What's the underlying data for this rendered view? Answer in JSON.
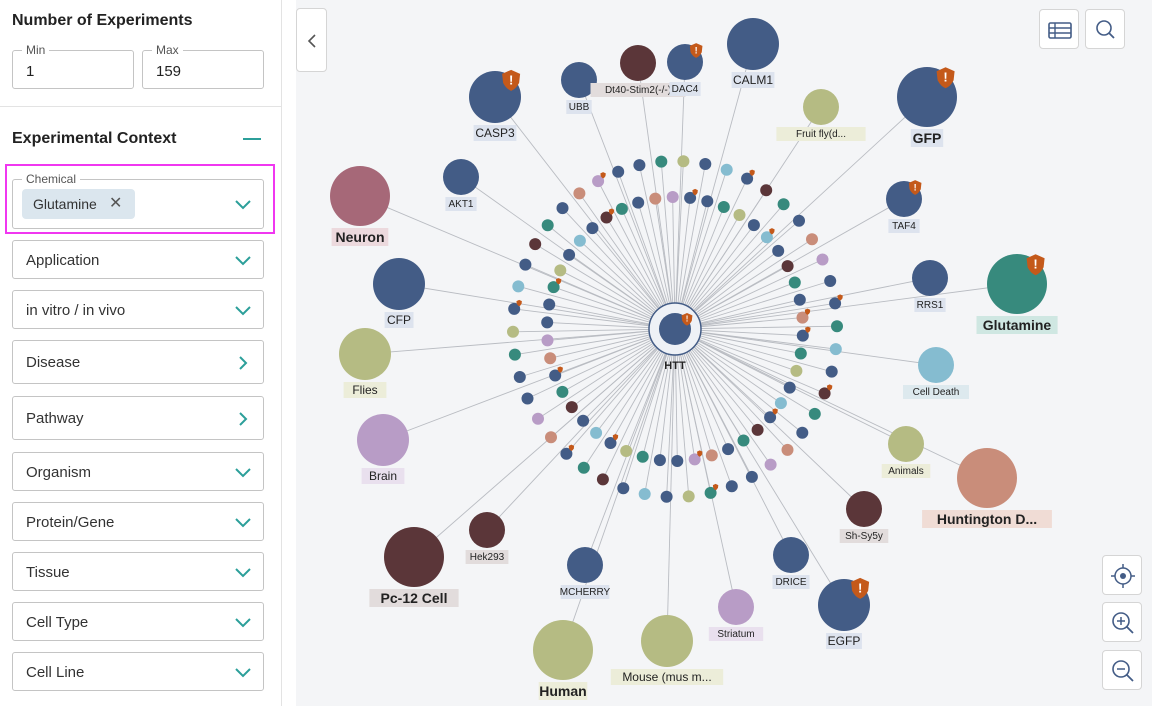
{
  "sidebar": {
    "experiments_title": "Number of Experiments",
    "min": {
      "label": "Min",
      "value": "1"
    },
    "max": {
      "label": "Max",
      "value": "159"
    },
    "context_title": "Experimental Context",
    "chemical": {
      "label": "Chemical",
      "chip": "Glutamine"
    },
    "filters": [
      {
        "label": "Application",
        "arrow": "down"
      },
      {
        "label": "in vitro / in vivo",
        "arrow": "down"
      },
      {
        "label": "Disease",
        "arrow": "right"
      },
      {
        "label": "Pathway",
        "arrow": "right"
      },
      {
        "label": "Organism",
        "arrow": "down"
      },
      {
        "label": "Protein/Gene",
        "arrow": "down"
      },
      {
        "label": "Tissue",
        "arrow": "down"
      },
      {
        "label": "Cell Type",
        "arrow": "down"
      },
      {
        "label": "Cell Line",
        "arrow": "down"
      }
    ]
  },
  "toolbar": {
    "collapse_icon": "chevron-left-icon",
    "table_icon": "table-icon",
    "search_icon": "search-icon",
    "center_icon": "crosshair-icon",
    "zoom_in_icon": "zoom-in-icon",
    "zoom_out_icon": "zoom-out-icon"
  },
  "colors": {
    "navy": "#435c86",
    "teal": "#378a7d",
    "olive": "#b5bb83",
    "lightblue": "#85bcd0",
    "mauve": "#a66878",
    "lavender": "#b89cc6",
    "darkbrown": "#5b3639",
    "salmon": "#c98d7a",
    "warning": "#c4591a",
    "highlight": "#f037f0",
    "accent": "#2c9f9a"
  },
  "graph": {
    "center": {
      "label": "HTT",
      "color": "navy",
      "warning": true
    },
    "nodes": [
      {
        "label": "CASP3",
        "color": "navy",
        "size": "m",
        "warning": true
      },
      {
        "label": "UBB",
        "color": "navy",
        "size": "s",
        "warning": false
      },
      {
        "label": "Dt40-Stim2(-/-)",
        "color": "darkbrown",
        "size": "s",
        "warning": false
      },
      {
        "label": "DAC4",
        "color": "navy",
        "size": "s",
        "warning": true
      },
      {
        "label": "CALM1",
        "color": "navy",
        "size": "m",
        "warning": false
      },
      {
        "label": "Fruit fly(d...",
        "color": "olive",
        "size": "s",
        "warning": false
      },
      {
        "label": "GFP",
        "color": "navy",
        "size": "l",
        "warning": true
      },
      {
        "label": "Neuron",
        "color": "mauve",
        "size": "l",
        "warning": false
      },
      {
        "label": "AKT1",
        "color": "navy",
        "size": "s",
        "warning": false
      },
      {
        "label": "TAF4",
        "color": "navy",
        "size": "s",
        "warning": true
      },
      {
        "label": "CFP",
        "color": "navy",
        "size": "m",
        "warning": false
      },
      {
        "label": "RRS1",
        "color": "navy",
        "size": "s",
        "warning": false
      },
      {
        "label": "Glutamine",
        "color": "teal",
        "size": "l",
        "warning": true
      },
      {
        "label": "Flies",
        "color": "olive",
        "size": "m",
        "warning": false
      },
      {
        "label": "Cell Death",
        "color": "lightblue",
        "size": "s",
        "warning": false
      },
      {
        "label": "Brain",
        "color": "lavender",
        "size": "m",
        "warning": false
      },
      {
        "label": "Animals",
        "color": "olive",
        "size": "s",
        "warning": false
      },
      {
        "label": "Huntington D...",
        "color": "salmon",
        "size": "l",
        "warning": false
      },
      {
        "label": "Hek293",
        "color": "darkbrown",
        "size": "s",
        "warning": false
      },
      {
        "label": "Sh-Sy5y",
        "color": "darkbrown",
        "size": "s",
        "warning": false
      },
      {
        "label": "Pc-12 Cell",
        "color": "darkbrown",
        "size": "l",
        "warning": false
      },
      {
        "label": "MCHERRY",
        "color": "navy",
        "size": "s",
        "warning": false
      },
      {
        "label": "DRICE",
        "color": "navy",
        "size": "s",
        "warning": false
      },
      {
        "label": "Striatum",
        "color": "lavender",
        "size": "s",
        "warning": false
      },
      {
        "label": "EGFP",
        "color": "navy",
        "size": "m",
        "warning": true
      },
      {
        "label": "Human",
        "color": "olive",
        "size": "l",
        "warning": false
      },
      {
        "label": "Mouse (mus m...",
        "color": "olive",
        "size": "m",
        "warning": false
      }
    ]
  }
}
